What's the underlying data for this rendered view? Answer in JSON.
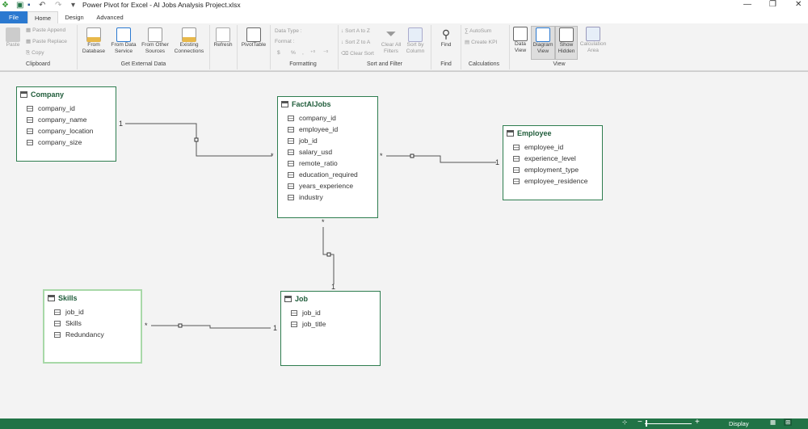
{
  "window": {
    "title": "Power Pivot for Excel - AI Jobs Analysis Project.xlsx"
  },
  "tabs": [
    {
      "label": "File"
    },
    {
      "label": "Home"
    },
    {
      "label": "Design"
    },
    {
      "label": "Advanced"
    }
  ],
  "ribbon": {
    "clipboard": {
      "paste": "Paste",
      "paste_append": "Paste Append",
      "paste_replace": "Paste Replace",
      "copy": "Copy",
      "group": "Clipboard"
    },
    "external": {
      "from_database": "From Database",
      "from_data_service": "From Data Service",
      "from_other": "From Other Sources",
      "existing": "Existing Connections",
      "group": "Get External Data"
    },
    "refresh": "Refresh",
    "pivottable": "PivotTable",
    "formatting": {
      "data_type": "Data Type :",
      "format": "Format :",
      "dollar": "$",
      "percent": "%",
      "comma": ",",
      "group": "Formatting"
    },
    "sort": {
      "az": "Sort A to Z",
      "za": "Sort Z to A",
      "clear_sort": "Clear Sort",
      "clear_filters": "Clear All Filters",
      "sort_by_column": "Sort by Column",
      "group": "Sort and Filter"
    },
    "find": {
      "label": "Find",
      "group": "Find"
    },
    "calc": {
      "autosum": "AutoSum",
      "kpi": "Create KPI",
      "group": "Calculations"
    },
    "view": {
      "data_view": "Data View",
      "diagram_view": "Diagram View",
      "show_hidden": "Show Hidden",
      "calc_area": "Calculation Area",
      "group": "View"
    }
  },
  "tables": {
    "company": {
      "name": "Company",
      "columns": [
        "company_id",
        "company_name",
        "company_location",
        "company_size"
      ]
    },
    "fact": {
      "name": "FactAIJobs",
      "columns": [
        "company_id",
        "employee_id",
        "job_id",
        "salary_usd",
        "remote_ratio",
        "education_required",
        "years_experience",
        "industry"
      ]
    },
    "employee": {
      "name": "Employee",
      "columns": [
        "employee_id",
        "experience_level",
        "employment_type",
        "employee_residence"
      ]
    },
    "skills": {
      "name": "Skills",
      "columns": [
        "job_id",
        "Skills",
        "Redundancy"
      ]
    },
    "job": {
      "name": "Job",
      "columns": [
        "job_id",
        "job_title"
      ]
    }
  },
  "relations": {
    "one": "1",
    "many": "*"
  },
  "status": {
    "display": "Display",
    "zoom_minus": "−",
    "zoom_plus": "+"
  },
  "colors": {
    "accent": "#217346",
    "file_tab": "#2b79d0"
  }
}
